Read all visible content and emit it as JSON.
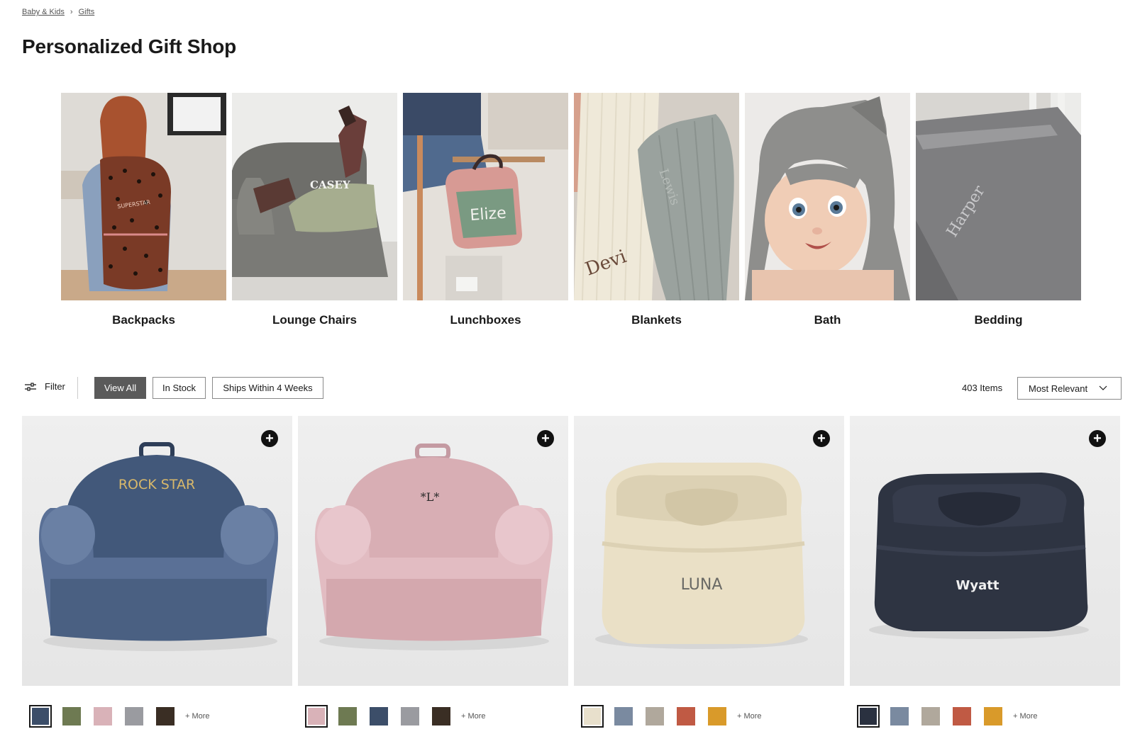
{
  "breadcrumb": [
    {
      "label": "Baby & Kids"
    },
    {
      "label": "Gifts"
    }
  ],
  "page_title": "Personalized Gift Shop",
  "categories": [
    {
      "label": "Backpacks",
      "image_text": "SUPERSTAR"
    },
    {
      "label": "Lounge Chairs",
      "image_text": "CASEY"
    },
    {
      "label": "Lunchboxes",
      "image_text": "Elize"
    },
    {
      "label": "Blankets",
      "image_text": "Devi",
      "image_text_2": "Lewis"
    },
    {
      "label": "Bath"
    },
    {
      "label": "Bedding",
      "image_text": "Harper"
    }
  ],
  "toolbar": {
    "filter_label": "Filter",
    "chips": [
      "View All",
      "In Stock",
      "Ships Within 4 Weeks"
    ],
    "active_chip": "View All",
    "item_count": "403 Items",
    "sort_label": "Most Relevant"
  },
  "products": [
    {
      "personalization": "ROCK STAR",
      "more_label": "+ More",
      "swatches": [
        "#3c4e69",
        "#6e7a52",
        "#d9b2b8",
        "#9a9ba0",
        "#3a2e24"
      ]
    },
    {
      "personalization": "*L*",
      "more_label": "+ More",
      "swatches": [
        "#d9b2b8",
        "#6e7a52",
        "#3c4e69",
        "#9a9ba0",
        "#3a2e24"
      ]
    },
    {
      "personalization": "LUNA",
      "more_label": "+ More",
      "swatches": [
        "#e8e0cc",
        "#7a8aa0",
        "#b0a89c",
        "#c05a44",
        "#d99a2a"
      ]
    },
    {
      "personalization": "Wyatt",
      "more_label": "+ More",
      "swatches": [
        "#2a3140",
        "#7a8aa0",
        "#b0a89c",
        "#c05a44",
        "#d99a2a"
      ]
    }
  ]
}
